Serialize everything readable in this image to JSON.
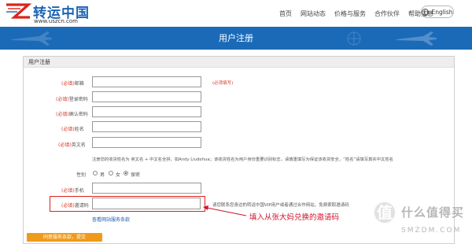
{
  "header": {
    "logo_text": "转运中国",
    "logo_url": "www.uszcn.com",
    "nav": [
      "首页",
      "网站动态",
      "价格与服务",
      "合作伙伴",
      "帮助信息"
    ],
    "language_label": "English"
  },
  "banner": {
    "title": "用户注册"
  },
  "form": {
    "panel_title": "用户注册",
    "required_prefix": "(必填)",
    "fields": {
      "email": {
        "label": "邮箱",
        "value": ""
      },
      "password": {
        "label": "登录密码",
        "value": ""
      },
      "confirm_password": {
        "label": "确认密码",
        "value": ""
      },
      "name": {
        "label": "姓名",
        "value": ""
      },
      "english_name": {
        "label": "英文名",
        "value": ""
      },
      "phone": {
        "label": "手机",
        "value": ""
      },
      "invite_code": {
        "label": "邀请码",
        "value": ""
      }
    },
    "email_hint": "(必须填写)",
    "name_note": "注册您的收货姓名为 英文名 + 中文名全拼，如Andy Liudehua；该收货姓名为用户身份重要识别标志，请慎重填写为保证该收货安全，“姓名”请填写真实中文姓名",
    "gender": {
      "label": "性别",
      "options": [
        "男",
        "女",
        "保密"
      ],
      "selected": "保密"
    },
    "invite_hint": "请您联系您身边的转运中国VIP用户或者通过合作网站，免费索取邀请码",
    "terms_link": "查看网站服务条款",
    "submit_label": "同意服务条款，提交"
  },
  "annotation": {
    "callout": "填入从张大妈兑换的邀请码",
    "color": "#d0142c"
  },
  "watermark": {
    "badge": "值",
    "text": "什么值得买",
    "domain": "SMZDM.COM"
  },
  "colors": {
    "brand_blue": "#1a6ab8",
    "required_red": "#d23b2a",
    "submit_orange": "#f09a1c"
  }
}
